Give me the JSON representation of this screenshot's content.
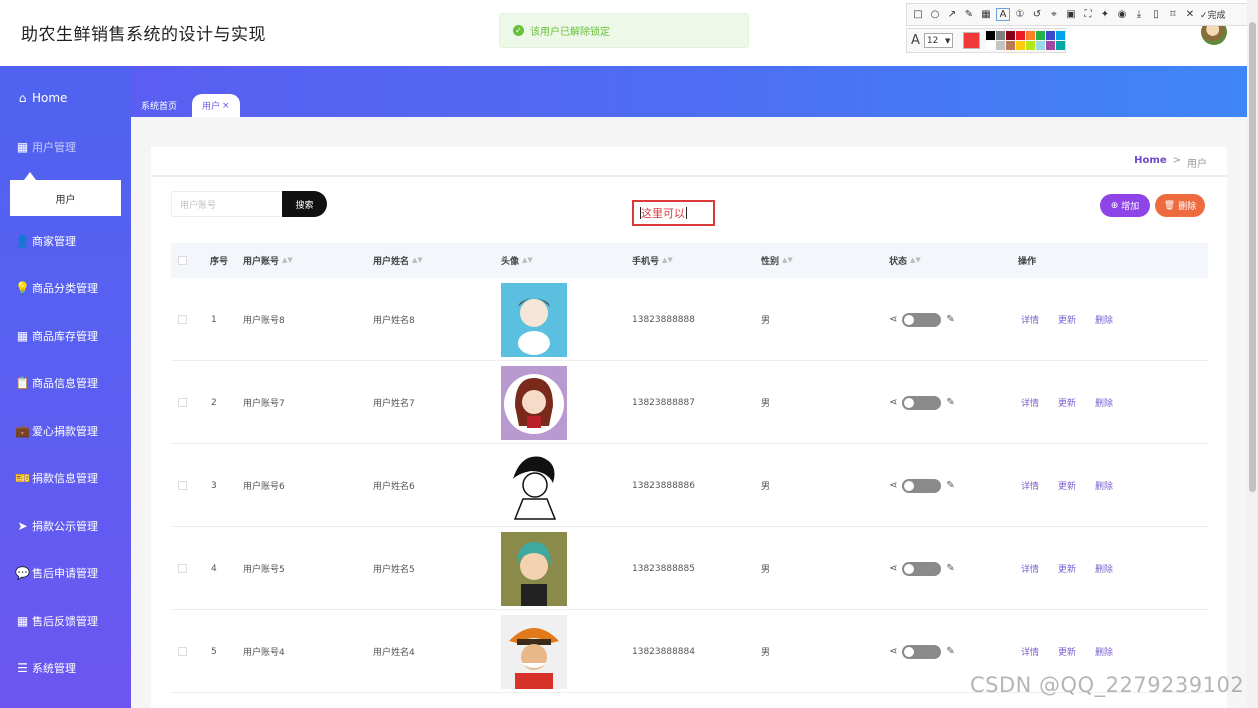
{
  "app": {
    "title": "助农生鲜销售系统的设计与实现"
  },
  "toast": {
    "message": "该用户已解除锁定"
  },
  "snip_tool": {
    "done_label": "完成",
    "font_size": "12",
    "active_color": "#f03a3a",
    "icons": [
      "rect-icon",
      "ellipse-icon",
      "arrow-icon",
      "pen-icon",
      "mosaic-icon",
      "text-icon",
      "number-icon",
      "undo-icon",
      "pin-icon",
      "ocr-icon",
      "crop-icon",
      "pin-top-icon",
      "record-icon",
      "download-icon",
      "phone-icon",
      "bookmark-icon",
      "close-icon",
      "check-icon"
    ],
    "palette": [
      "#000000",
      "#7f7f7f",
      "#880015",
      "#ed1c24",
      "#ff7f27",
      "#22b14c",
      "#3f48cc",
      "#00a2e8",
      "#ffffff",
      "#c3c3c3",
      "#b97a57",
      "#ffc90e",
      "#b5e61d",
      "#99d9ea",
      "#a349a4",
      "#00a6a6"
    ]
  },
  "sidebar": {
    "home": "Home",
    "items": [
      {
        "label": "用户管理",
        "icon": "grid-icon"
      },
      {
        "label": "商家管理",
        "icon": "user-icon"
      },
      {
        "label": "商品分类管理",
        "icon": "bulb-icon"
      },
      {
        "label": "商品库存管理",
        "icon": "grid-icon"
      },
      {
        "label": "商品信息管理",
        "icon": "clipboard-icon"
      },
      {
        "label": "爱心捐款管理",
        "icon": "briefcase-icon"
      },
      {
        "label": "捐款信息管理",
        "icon": "ticket-icon"
      },
      {
        "label": "捐款公示管理",
        "icon": "send-icon"
      },
      {
        "label": "售后申请管理",
        "icon": "chat-icon"
      },
      {
        "label": "售后反馈管理",
        "icon": "grid-icon"
      },
      {
        "label": "系统管理",
        "icon": "list-icon"
      }
    ],
    "active_sub": "用户"
  },
  "tabs": {
    "home": "系统首页",
    "active": "用户",
    "close": "×"
  },
  "breadcrumb": {
    "home": "Home",
    "sep": ">",
    "current": "用户"
  },
  "search": {
    "placeholder": "用户账号",
    "button": "搜索"
  },
  "annotation": {
    "text": "这里可以"
  },
  "actions": {
    "add": "增加",
    "delete": "删除"
  },
  "table": {
    "headers": {
      "index": "序号",
      "account": "用户账号",
      "name": "用户姓名",
      "avatar": "头像",
      "phone": "手机号",
      "gender": "性别",
      "status": "状态",
      "ops": "操作"
    },
    "row_actions": {
      "detail": "详情",
      "update": "更新",
      "delete": "删除"
    },
    "rows": [
      {
        "index": "1",
        "account": "用户账号8",
        "name": "用户姓名8",
        "phone": "13823888888",
        "gender": "男"
      },
      {
        "index": "2",
        "account": "用户账号7",
        "name": "用户姓名7",
        "phone": "13823888887",
        "gender": "男"
      },
      {
        "index": "3",
        "account": "用户账号6",
        "name": "用户姓名6",
        "phone": "13823888886",
        "gender": "男"
      },
      {
        "index": "4",
        "account": "用户账号5",
        "name": "用户姓名5",
        "phone": "13823888885",
        "gender": "男"
      },
      {
        "index": "5",
        "account": "用户账号4",
        "name": "用户姓名4",
        "phone": "13823888884",
        "gender": "男"
      }
    ]
  },
  "watermark": "CSDN @QQ_2279239102"
}
